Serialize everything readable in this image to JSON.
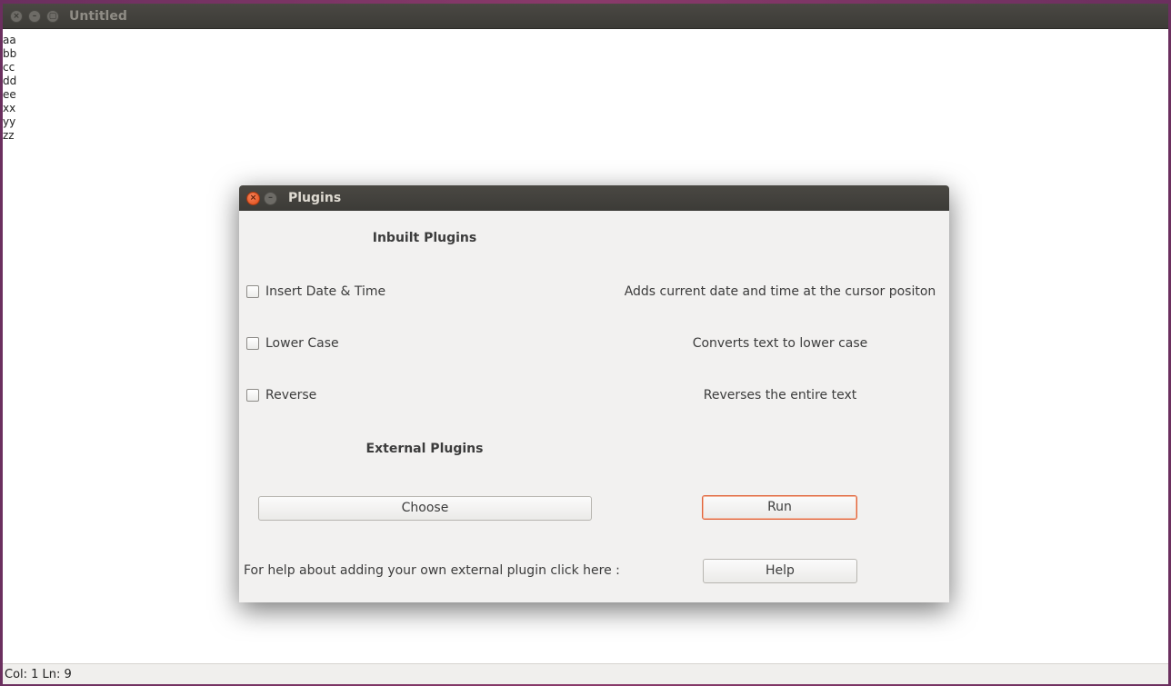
{
  "main_window": {
    "title": "Untitled",
    "window_buttons": {
      "close": "×",
      "minimize": "–",
      "maximize": "▢"
    },
    "editor_lines": [
      "aa",
      "bb",
      "cc",
      "dd",
      "ee",
      "xx",
      "yy",
      "zz"
    ],
    "status": "Col: 1 Ln: 9"
  },
  "dialog": {
    "title": "Plugins",
    "close_glyph": "×",
    "minimize_glyph": "–",
    "inbuilt_heading": "Inbuilt Plugins",
    "plugins": [
      {
        "label": "Insert Date & Time",
        "description": "Adds current date and time at the cursor positon",
        "checked": false
      },
      {
        "label": "Lower Case",
        "description": "Converts text to lower case",
        "checked": false
      },
      {
        "label": "Reverse",
        "description": "Reverses the entire text",
        "checked": false
      }
    ],
    "external_heading": "External Plugins",
    "choose_label": "Choose",
    "run_label": "Run",
    "help_text": "For help about adding your own external plugin click here :",
    "help_label": "Help"
  },
  "colors": {
    "accent": "#df4a16",
    "titlebar": "#3c3b37",
    "dialog_bg": "#f2f1f0"
  }
}
